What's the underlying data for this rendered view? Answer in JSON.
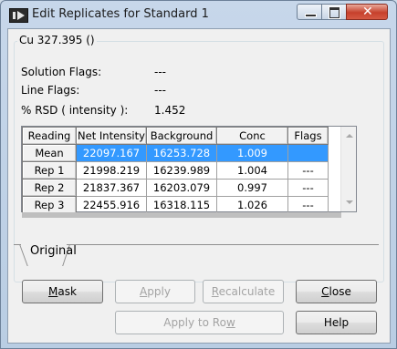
{
  "window": {
    "title": "Edit Replicates for Standard 1",
    "controls": {
      "minimize": "–",
      "maximize": "□",
      "close": "✕"
    }
  },
  "group": {
    "label": "Cu 327.395 ()",
    "solution_flags_label": "Solution Flags:",
    "solution_flags_value": "---",
    "line_flags_label": "Line Flags:",
    "line_flags_value": "---",
    "rsd_label": "% RSD ( intensity ):",
    "rsd_value": "1.452"
  },
  "table": {
    "headers": [
      "Reading",
      "Net Intensity",
      "Background",
      "Conc",
      "Flags"
    ],
    "rows": [
      {
        "reading": "Mean",
        "net": "22097.167",
        "background": "16253.728",
        "conc": "1.009",
        "flags": "",
        "selected": true
      },
      {
        "reading": "Rep 1",
        "net": "21998.219",
        "background": "16239.989",
        "conc": "1.004",
        "flags": "---"
      },
      {
        "reading": "Rep 2",
        "net": "21837.367",
        "background": "16203.079",
        "conc": "0.997",
        "flags": "---"
      },
      {
        "reading": "Rep 3",
        "net": "22455.916",
        "background": "16318.115",
        "conc": "1.026",
        "flags": "---"
      }
    ]
  },
  "tabs": {
    "original": "Original"
  },
  "buttons": {
    "mask": {
      "pre": "",
      "mnemonic": "M",
      "post": "ask"
    },
    "apply": {
      "pre": "",
      "mnemonic": "A",
      "post": "pply"
    },
    "recalculate": {
      "pre": "",
      "mnemonic": "R",
      "post": "ecalculate"
    },
    "close": {
      "pre": "",
      "mnemonic": "C",
      "post": "lose"
    },
    "apply_to_row": {
      "pre": "Apply to Ro",
      "mnemonic": "w",
      "post": ""
    },
    "help": "Help"
  },
  "colors": {
    "selection": "#3399ff",
    "window_frame": "#b9cde3",
    "close_button": "#c6402c"
  }
}
